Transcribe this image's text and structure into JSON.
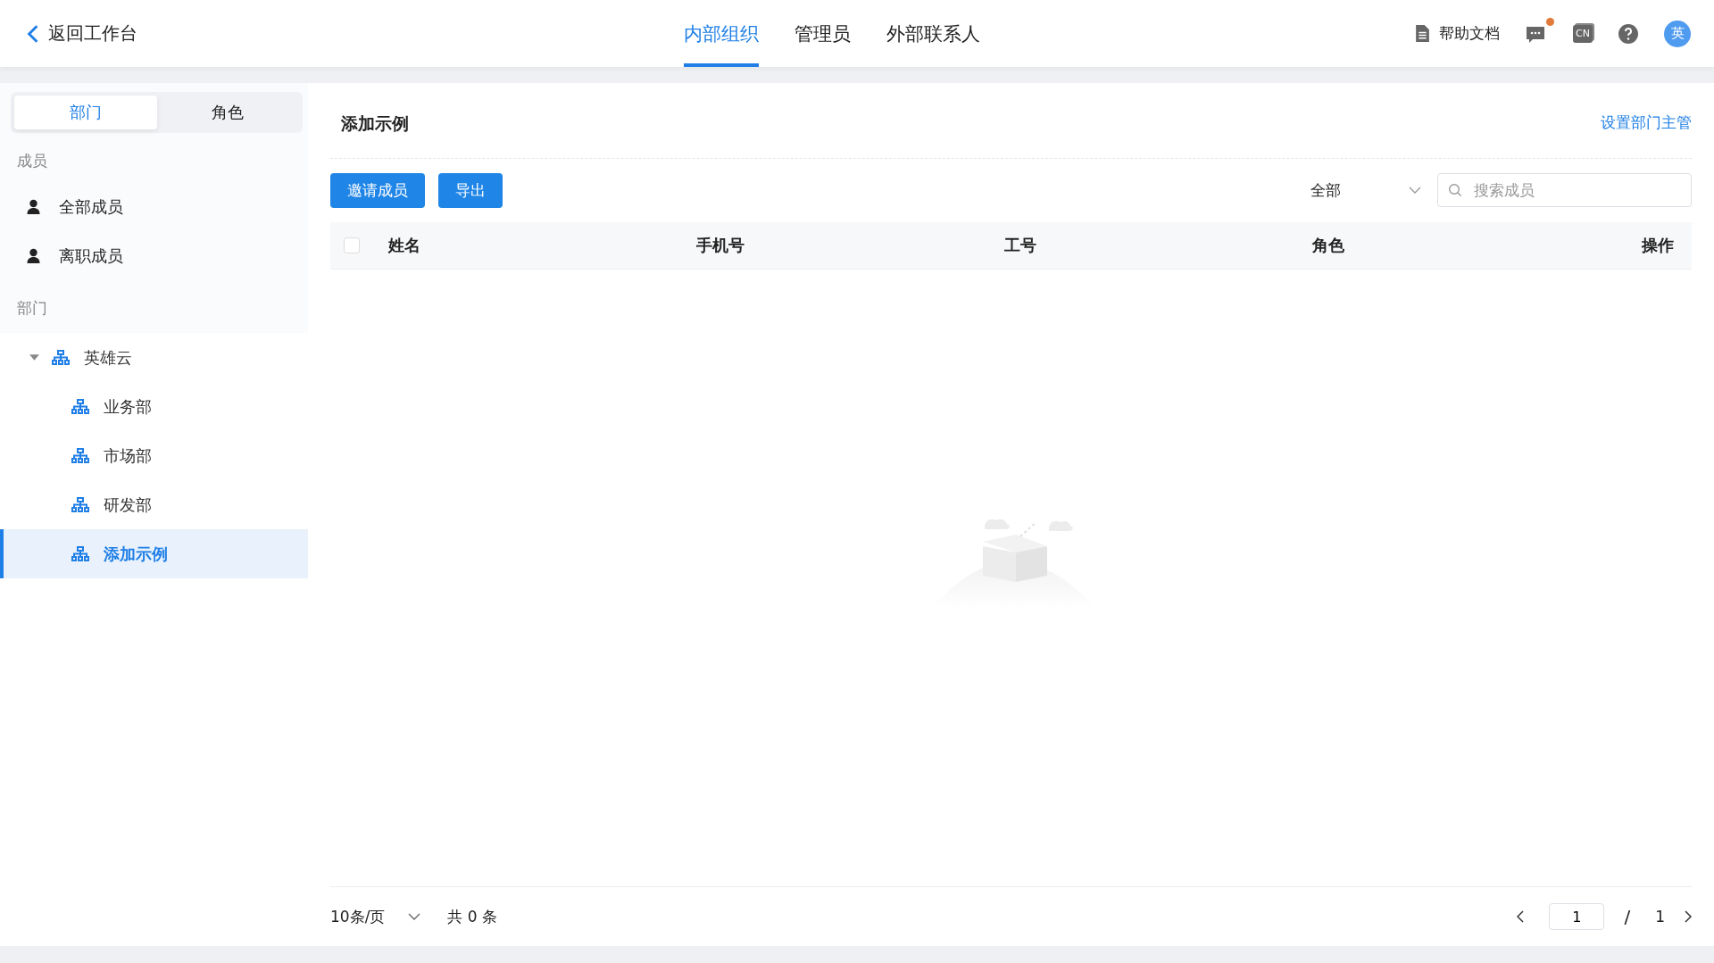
{
  "header": {
    "back": "返回工作台",
    "tabs": [
      {
        "label": "内部组织",
        "selected": true
      },
      {
        "label": "管理员",
        "selected": false
      },
      {
        "label": "外部联系人",
        "selected": false
      }
    ],
    "help": "帮助文档",
    "unread": true,
    "lang": "CN",
    "avatar": "英"
  },
  "sidebar": {
    "tabs": [
      {
        "label": "部门",
        "selected": true
      },
      {
        "label": "角色",
        "selected": false
      }
    ],
    "members_title": "成员",
    "members": [
      {
        "label": "全部成员"
      },
      {
        "label": "离职成员"
      }
    ],
    "departments_title": "部门",
    "tree": [
      {
        "label": "英雄云",
        "expanded": true,
        "selected": false,
        "children": [
          {
            "label": "业务部",
            "selected": false
          },
          {
            "label": "市场部",
            "selected": false
          },
          {
            "label": "研发部",
            "selected": false
          },
          {
            "label": "添加示例",
            "selected": true
          }
        ]
      }
    ]
  },
  "main": {
    "title": "添加示例",
    "link": "设置部门主管",
    "buttons": [
      "邀请成员",
      "导出"
    ],
    "filter": {
      "value": "全部"
    },
    "search": {
      "placeholder": "搜索成员"
    },
    "table": {
      "select_all": false,
      "columns": [
        "姓名",
        "手机号",
        "工号",
        "角色",
        "操作"
      ]
    },
    "pagination": {
      "page_size": "10条/页",
      "total": "共 0 条",
      "page": "1",
      "separator": "/",
      "pages": "1"
    }
  }
}
